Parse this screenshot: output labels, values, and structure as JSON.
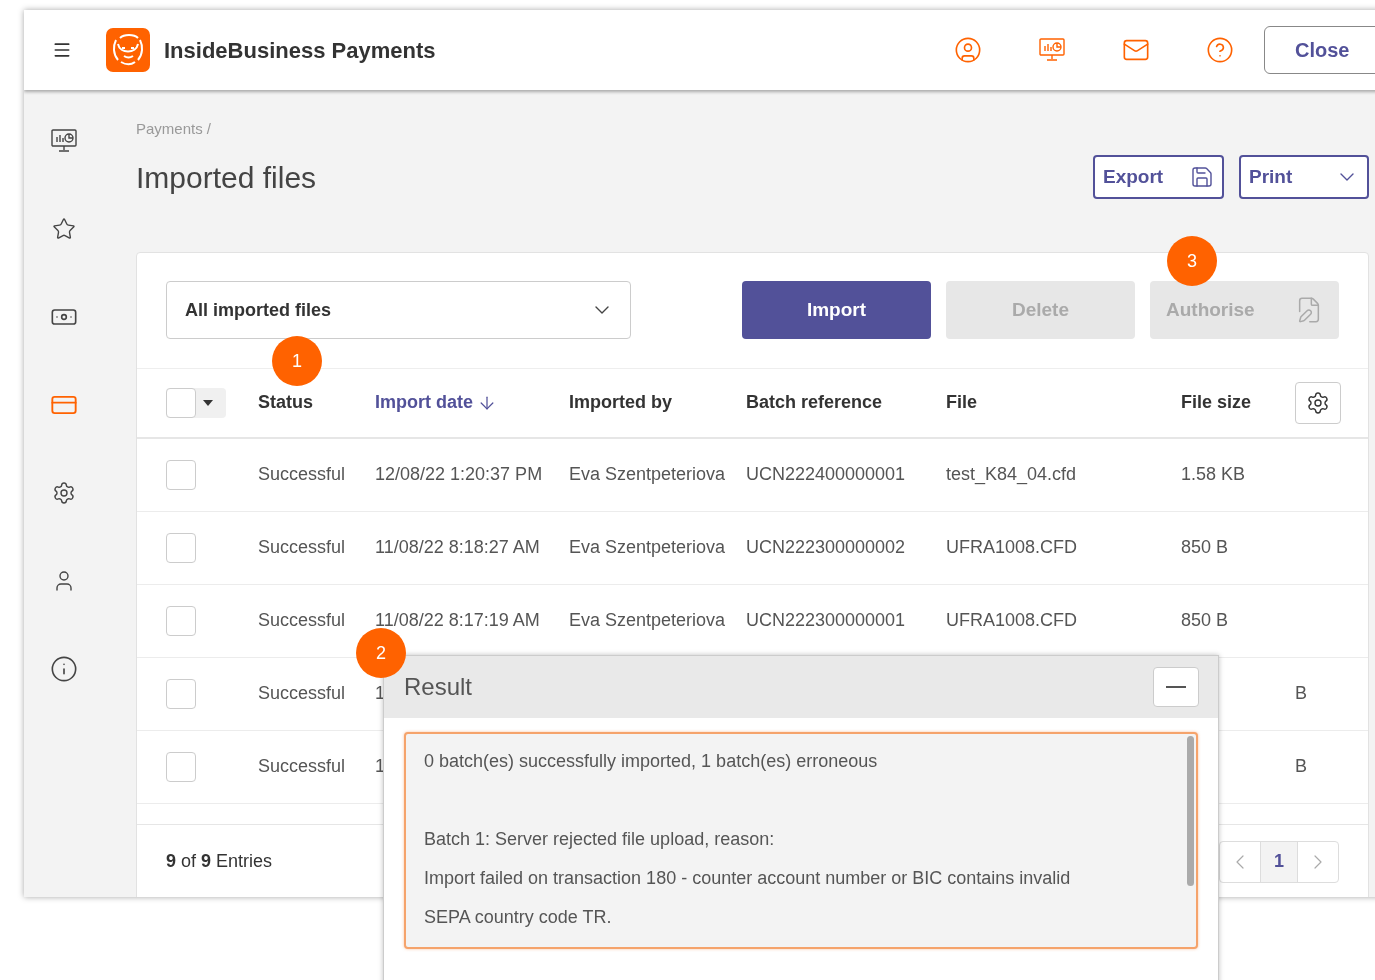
{
  "header": {
    "app_name": "InsideBusiness Payments",
    "close_button": "Close"
  },
  "sidebar": {
    "items": [
      {
        "kind": "dashboard",
        "selected": false
      },
      {
        "kind": "favourites",
        "selected": false
      },
      {
        "kind": "money",
        "selected": false
      },
      {
        "kind": "payments",
        "selected": true
      },
      {
        "kind": "settings",
        "selected": false
      },
      {
        "kind": "profile",
        "selected": false
      },
      {
        "kind": "info",
        "selected": false
      }
    ]
  },
  "breadcrumb": [
    "Payments",
    "/"
  ],
  "page_title": "Imported files",
  "actions": {
    "export": "Export",
    "print": "Print"
  },
  "filter": {
    "value": "All imported files"
  },
  "toolbar": [
    {
      "label": "Import",
      "disabled": false
    },
    {
      "label": "Delete",
      "disabled": true
    },
    {
      "label": "Authorise",
      "disabled": true
    }
  ],
  "table": {
    "select_all": {
      "checked": false
    },
    "columns": [
      {
        "label": "Status",
        "sorted": false
      },
      {
        "label": "Import date",
        "sorted": true
      },
      {
        "label": "Imported by",
        "sorted": false
      },
      {
        "label": "Batch reference",
        "sorted": false
      },
      {
        "label": "File",
        "sorted": false
      },
      {
        "label": "File size",
        "sorted": false
      }
    ],
    "rows": [
      {
        "kind": "full",
        "checked": false,
        "cells": [
          "Successful",
          "12/08/22 1:20:37 PM",
          "Eva Szentpeteriova",
          "UCN222400000001",
          "test_K84_04.cfd",
          "1.58 KB"
        ]
      },
      {
        "kind": "full",
        "checked": false,
        "cells": [
          "Successful",
          "11/08/22 8:18:27 AM",
          "Eva Szentpeteriova",
          "UCN222300000002",
          "UFRA1008.CFD",
          "850 B"
        ]
      },
      {
        "kind": "full",
        "checked": false,
        "cells": [
          "Successful",
          "11/08/22 8:17:19 AM",
          "Eva Szentpeteriova",
          "UCN222300000001",
          "UFRA1008.CFD",
          "850 B"
        ]
      },
      {
        "kind": "partly_hidden",
        "checked": false,
        "cells": [
          "Successful",
          "1",
          "B"
        ]
      },
      {
        "kind": "partly_hidden",
        "checked": false,
        "cells": [
          "Successful",
          "1",
          "B"
        ]
      }
    ]
  },
  "footer": {
    "count": "9",
    "of": "of",
    "total": "9",
    "entries": "Entries",
    "pages": [
      {
        "label": "1",
        "selected": true
      }
    ]
  },
  "dialog": {
    "title": "Result",
    "paragraphs": [
      [
        "0 batch(es) successfully imported, 1 batch(es) erroneous"
      ],
      [
        "Batch 1: Server rejected file upload, reason:",
        "Import failed on transaction 180 - counter account number or BIC contains invalid",
        "SEPA country code TR."
      ]
    ]
  },
  "markers": [
    "1",
    "2",
    "3"
  ]
}
